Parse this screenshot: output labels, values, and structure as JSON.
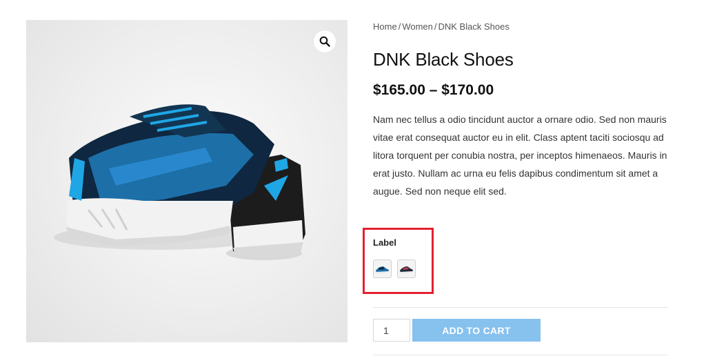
{
  "breadcrumb": {
    "items": [
      "Home",
      "Women",
      "DNK Black Shoes"
    ],
    "separator": "/"
  },
  "product": {
    "title": "DNK Black Shoes",
    "price": "$165.00 – $170.00",
    "description": "Nam nec tellus a odio tincidunt auctor a ornare odio. Sed non mauris vitae erat consequat auctor eu in elit. Class aptent taciti sociosqu ad litora torquent per conubia nostra, per inceptos himenaeos. Mauris in erat justo. Nullam ac urna eu felis dapibus condimentum sit amet a augue. Sed non neque elit sed.",
    "image_alt_icon": "shoe-image"
  },
  "variation": {
    "label": "Label",
    "swatches": [
      {
        "icon": "shoe-swatch-icon-blue"
      },
      {
        "icon": "shoe-swatch-icon-red"
      }
    ],
    "highlight_color": "#e3202f"
  },
  "cart": {
    "quantity": "1",
    "add_to_cart_label": "ADD TO CART",
    "button_color": "#87c1ee"
  },
  "icons": {
    "zoom": "magnifier-icon"
  }
}
